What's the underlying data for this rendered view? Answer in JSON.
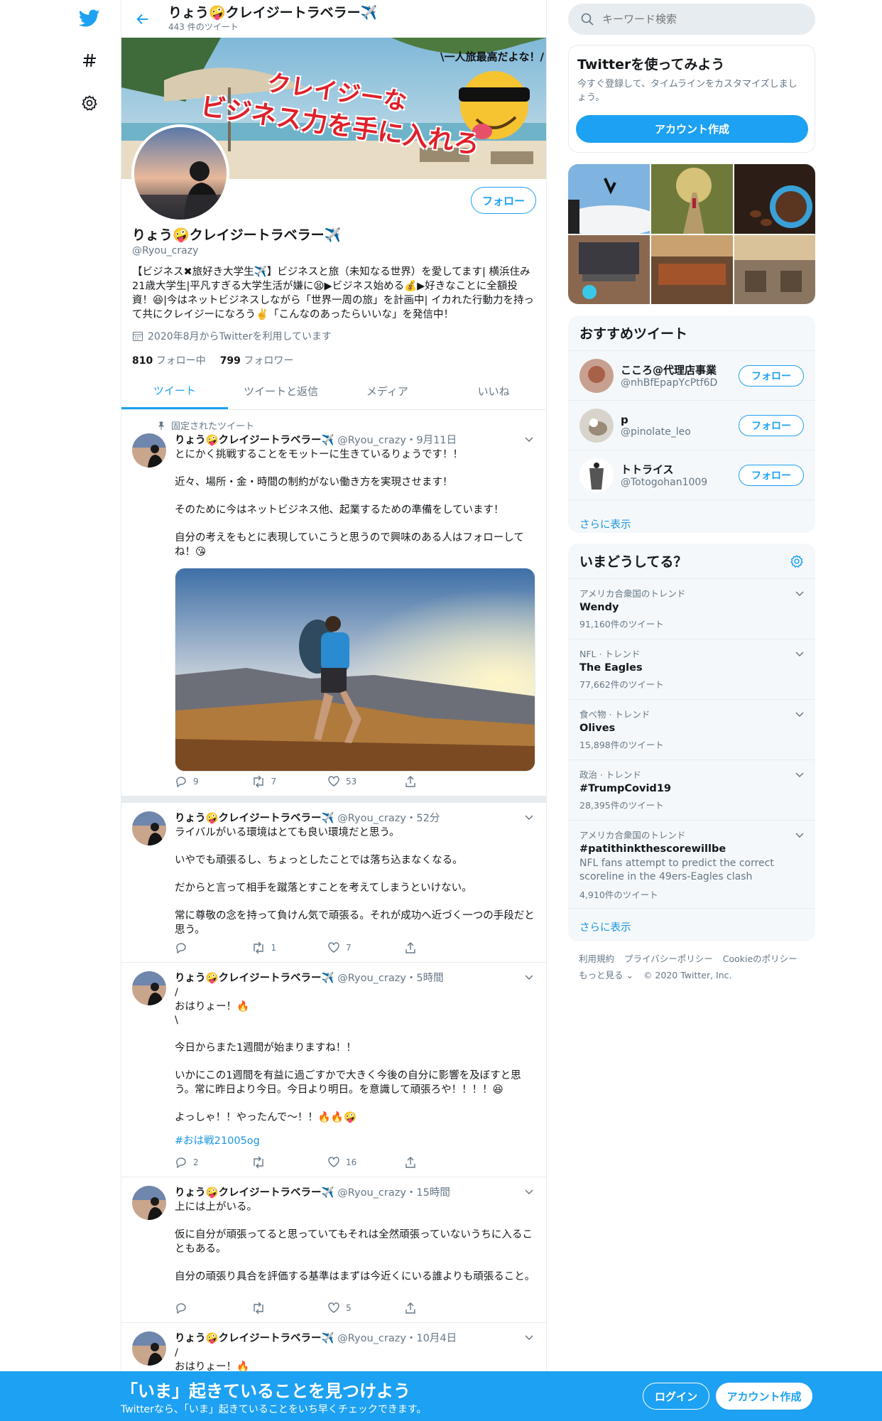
{
  "nav": {
    "icons": [
      "twitter-logo",
      "hashtag-icon",
      "settings-icon"
    ]
  },
  "header": {
    "name": "りょう🤪クレイジートラベラー✈️",
    "tweet_count": "443 件のツイート"
  },
  "banner": {
    "line1": "クレイジーな",
    "line2": "ビジネス力を手に入れろ",
    "tag": "\\一人旅最高だよな！/"
  },
  "profile": {
    "follow_label": "フォロー",
    "name": "りょう🤪クレイジートラベラー✈️",
    "handle": "@Ryou_crazy",
    "bio": "【ビジネス✖旅好き大学生✈️】ビジネスと旅（未知なる世界）を愛してます| 横浜住み21歳大学生|平凡すぎる大学生活が嫌に😫▶ビジネス始める💰▶好きなことに全額投資！😆|今はネットビジネスしながら「世界一周の旅」を計画中| イカれた行動力を持って共にクレイジーになろう✌️「こんなのあったらいいな」を発信中！",
    "joined": "2020年8月からTwitterを利用しています",
    "following_count": "810",
    "following_label": "フォロー中",
    "followers_count": "799",
    "followers_label": "フォロワー"
  },
  "tabs": [
    "ツイート",
    "ツイートと返信",
    "メディア",
    "いいね"
  ],
  "tweets": [
    {
      "pinned_label": "固定されたツイート",
      "name": "りょう🤪クレイジートラベラー✈️",
      "meta": "@Ryou_crazy・9月11日",
      "text": "とにかく挑戦することをモットーに生きているりょうです！！\n\n近々、場所・金・時間の制約がない働き方を実現させます！\n\nそのために今はネットビジネス他、起業するための準備をしています！\n\n自分の考えをもとに表現していこうと思うので興味のある人はフォローしてね！😘",
      "replies": "9",
      "retweets": "7",
      "likes": "53"
    },
    {
      "name": "りょう🤪クレイジートラベラー✈️",
      "meta": "@Ryou_crazy・52分",
      "text": "ライバルがいる環境はとても良い環境だと思う。\n\nいやでも頑張るし、ちょっとしたことでは落ち込まなくなる。\n\nだからと言って相手を蹴落とすことを考えてしまうといけない。\n\n常に尊敬の念を持って負けん気で頑張る。それが成功へ近づく一つの手段だと思う。",
      "replies": "",
      "retweets": "1",
      "likes": "7"
    },
    {
      "name": "りょう🤪クレイジートラベラー✈️",
      "meta": "@Ryou_crazy・5時間",
      "text": "/\nおはりょー！🔥\n\\\n\n今日からまた1週間が始まりますね！！\n\nいかにこの1週間を有益に過ごすかで大きく今後の自分に影響を及ぼすと思う。常に昨日より今日。今日より明日。を意識して頑張ろや！！！！😆\n\nよっしゃ！！やったんで〜！！🔥🔥🤪",
      "hashtag": "#おは戦21005og",
      "replies": "2",
      "retweets": "",
      "likes": "16"
    },
    {
      "name": "りょう🤪クレイジートラベラー✈️",
      "meta": "@Ryou_crazy・15時間",
      "text": "上には上がいる。\n\n仮に自分が頑張ってると思っていてもそれは全然頑張っていないうちに入ることもある。\n\n自分の頑張り具合を評価する基準はまずは今近くにいる誰よりも頑張ること。",
      "replies": "",
      "retweets": "",
      "likes": "5"
    },
    {
      "name": "りょう🤪クレイジートラベラー✈️",
      "meta": "@Ryou_crazy・10月4日",
      "text": "/\nおはりょー！🔥"
    }
  ],
  "right": {
    "search_placeholder": "キーワード検索",
    "try": {
      "title": "Twitterを使ってみよう",
      "sub": "今すぐ登録して、タイムラインをカスタマイズしましょう。",
      "button": "アカウント作成"
    },
    "recommend": {
      "title": "おすすめツイート",
      "users": [
        {
          "name": "こころ@代理店事業",
          "handle": "@nhBfEpapYcPtf6D",
          "button": "フォロー"
        },
        {
          "name": "p",
          "handle": "@pinolate_leo",
          "button": "フォロー"
        },
        {
          "name": "トトライス",
          "handle": "@Totogohan1009",
          "button": "フォロー"
        }
      ],
      "more": "さらに表示"
    },
    "trends": {
      "title": "いまどうしてる？",
      "items": [
        {
          "cat": "アメリカ合衆国のトレンド",
          "name": "Wendy",
          "count": "91,160件のツイート"
        },
        {
          "cat": "NFL · トレンド",
          "name": "The Eagles",
          "count": "77,662件のツイート"
        },
        {
          "cat": "食べ物 · トレンド",
          "name": "Olives",
          "count": "15,898件のツイート"
        },
        {
          "cat": "政治 · トレンド",
          "name": "#TrumpCovid19",
          "count": "28,395件のツイート"
        },
        {
          "cat": "アメリカ合衆国のトレンド",
          "name": "#patithinkthescorewillbe",
          "desc": "NFL fans attempt to predict the correct scoreline in the 49ers-Eagles clash",
          "count": "4,910件のツイート"
        }
      ],
      "more": "さらに表示"
    },
    "footer": {
      "terms": "利用規約",
      "privacy": "プライバシーポリシー",
      "cookie": "Cookieのポリシー",
      "more": "もっと見る ⌄",
      "copyright": "© 2020 Twitter, Inc."
    }
  },
  "bottom_bar": {
    "title": "「いま」起きていることを見つけよう",
    "sub": "Twitterなら、「いま」起きていることをいち早くチェックできます。",
    "login": "ログイン",
    "signup": "アカウント作成"
  }
}
